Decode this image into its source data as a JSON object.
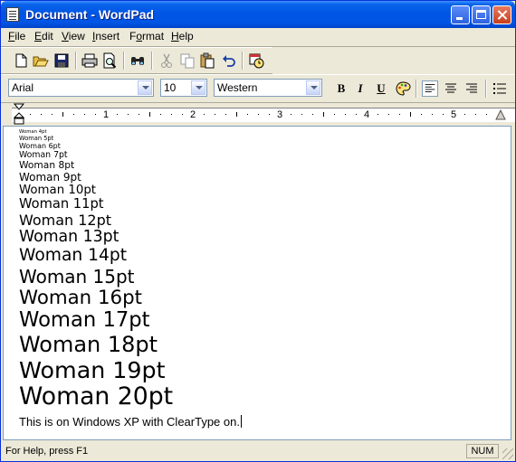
{
  "window": {
    "title": "Document - WordPad"
  },
  "menu": [
    {
      "label": "File",
      "u": "F",
      "rest": "ile"
    },
    {
      "label": "Edit",
      "u": "E",
      "rest": "dit"
    },
    {
      "label": "View",
      "u": "V",
      "rest": "iew"
    },
    {
      "label": "Insert",
      "u": "I",
      "rest": "nsert"
    },
    {
      "label": "Format",
      "pre": "F",
      "u": "o",
      "rest": "rmat"
    },
    {
      "label": "Help",
      "u": "H",
      "rest": "elp"
    }
  ],
  "toolbar": {
    "icons": [
      "new-icon",
      "open-icon",
      "save-icon",
      "print-icon",
      "print-preview-icon",
      "find-icon",
      "cut-icon",
      "copy-icon",
      "paste-icon",
      "undo-icon",
      "insert-datetime-icon"
    ]
  },
  "format": {
    "font": "Arial",
    "size": "10",
    "script": "Western",
    "bold": "B",
    "italic": "I",
    "underline": "U"
  },
  "ruler": {
    "numbers": [
      "1",
      "2",
      "3",
      "4",
      "5"
    ]
  },
  "document": {
    "lines": [
      {
        "text": "Woman 4pt",
        "size": 4
      },
      {
        "text": "Woman 5pt",
        "size": 5
      },
      {
        "text": "Woman 6pt",
        "size": 6
      },
      {
        "text": "Woman 7pt",
        "size": 7
      },
      {
        "text": "Woman 8pt",
        "size": 8
      },
      {
        "text": "Woman 9pt",
        "size": 9
      },
      {
        "text": "Woman 10pt",
        "size": 10
      },
      {
        "text": "Woman 11pt",
        "size": 11
      },
      {
        "text": "Woman 12pt",
        "size": 12
      },
      {
        "text": "Woman 13pt",
        "size": 13
      },
      {
        "text": "Woman 14pt",
        "size": 14
      },
      {
        "text": "Woman 15pt",
        "size": 15
      },
      {
        "text": "Woman 16pt",
        "size": 16
      },
      {
        "text": "Woman 17pt",
        "size": 17
      },
      {
        "text": "Woman 18pt",
        "size": 18
      },
      {
        "text": "Woman 19pt",
        "size": 19
      },
      {
        "text": "Woman 20pt",
        "size": 20
      }
    ],
    "last_line": "This is on Windows XP with ClearType on."
  },
  "status": {
    "help": "For Help, press F1",
    "num": "NUM"
  },
  "colors": {
    "titlebar": "#0055E5",
    "chrome": "#ECE9D8"
  }
}
